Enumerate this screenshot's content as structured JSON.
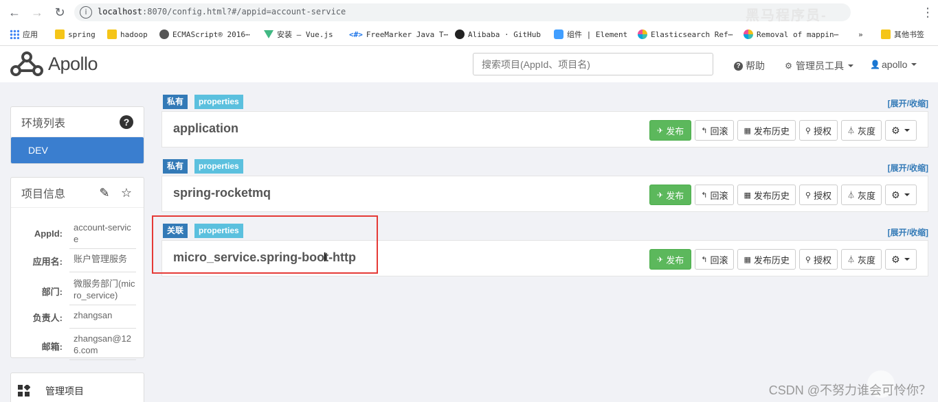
{
  "browser": {
    "url_host": "localhost",
    "url_rest": ":8070/config.html?#/appid=account-service",
    "watermark": "黑马程序员-",
    "bookmarks": [
      {
        "label": "应用",
        "icon": "grid-icon"
      },
      {
        "label": "spring",
        "icon": "folder-icon"
      },
      {
        "label": "hadoop",
        "icon": "folder-icon"
      },
      {
        "label": "ECMAScript® 2016⋯",
        "icon": "globe-icon"
      },
      {
        "label": "安装 — Vue.js",
        "icon": "vue-icon"
      },
      {
        "label": "FreeMarker Java T⋯",
        "icon": "freemarker-icon"
      },
      {
        "label": "Alibaba · GitHub",
        "icon": "github-icon"
      },
      {
        "label": "组件 | Element",
        "icon": "element-icon"
      },
      {
        "label": "Elasticsearch Ref⋯",
        "icon": "elasticsearch-icon"
      },
      {
        "label": "Removal of mappin⋯",
        "icon": "elasticsearch-icon"
      },
      {
        "label": "»",
        "icon": ""
      },
      {
        "label": "其他书签",
        "icon": "folder-icon"
      }
    ]
  },
  "header": {
    "logo_text": "Apollo",
    "search_placeholder": "搜索项目(AppId、项目名)",
    "help": "帮助",
    "admin_tools": "管理员工具",
    "user": "apollo"
  },
  "sidebar": {
    "env_title": "环境列表",
    "envs": [
      "DEV"
    ],
    "project_title": "项目信息",
    "info": [
      {
        "key": "AppId:",
        "value": "account-service"
      },
      {
        "key": "应用名:",
        "value": "账户管理服务"
      },
      {
        "key": "部门:",
        "value": "微服务部门(micro_service)"
      },
      {
        "key": "负责人:",
        "value": "zhangsan"
      },
      {
        "key": "邮箱:",
        "value": "zhangsan@126.com"
      }
    ],
    "manage_project": "管理项目"
  },
  "namespaces": [
    {
      "scope": "私有",
      "format": "properties",
      "name": "application"
    },
    {
      "scope": "私有",
      "format": "properties",
      "name": "spring-rocketmq"
    },
    {
      "scope": "关联",
      "format": "properties",
      "name": "micro_service.spring-boot-http"
    }
  ],
  "labels": {
    "expand_collapse": "[展开/收缩]",
    "publish": "发布",
    "rollback": "回滚",
    "history": "发布历史",
    "authorize": "授权",
    "gray": "灰度"
  },
  "footer": {
    "watermark": "CSDN @不努力谁会可怜你？"
  },
  "colors": {
    "primary": "#337ab7",
    "info": "#5bc0de",
    "success": "#5cb85c",
    "env_active": "#3a7ecf",
    "highlight": "#e53935"
  }
}
